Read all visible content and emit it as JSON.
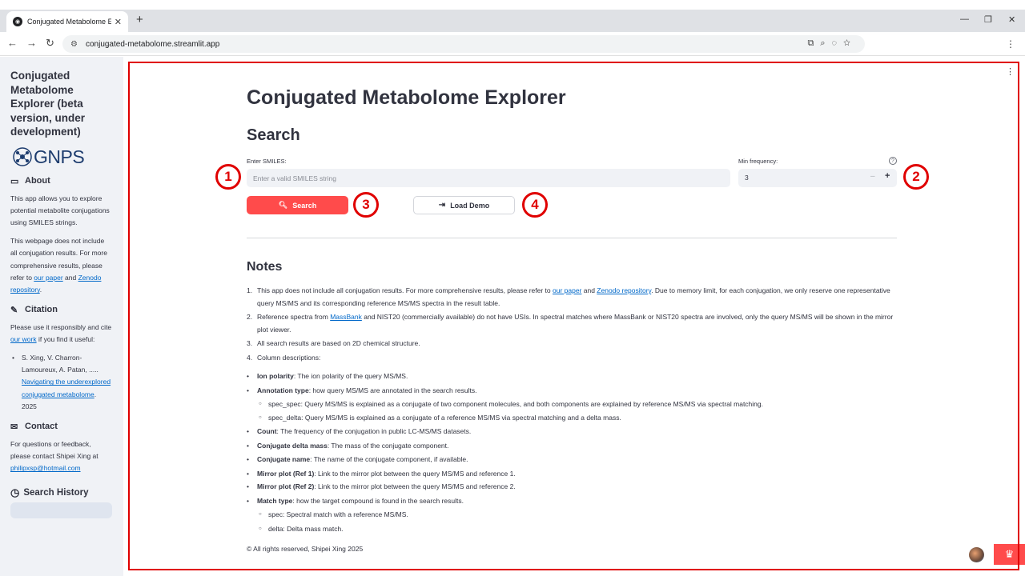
{
  "browser": {
    "tab_title": "Conjugated Metabolome Explo",
    "tab_close": "✕",
    "new_tab": "+",
    "url": "conjugated-metabolome.streamlit.app",
    "minimize": "—",
    "restore": "❐",
    "close": "✕"
  },
  "sidebar": {
    "title": "Conjugated Metabolome Explorer (beta version, under development)",
    "logo_text": "GNPS",
    "about_heading": "About",
    "about_p1": "This app allows you to explore potential metabolite conjugations using SMILES strings.",
    "about_p2_pre": "This webpage does not include all conjugation results. For more comprehensive results, please refer to ",
    "about_p2_link1": "our paper",
    "about_p2_mid": " and ",
    "about_p2_link2": "Zenodo repository",
    "about_p2_end": ".",
    "citation_heading": "Citation",
    "citation_pre": "Please use it responsibly and cite ",
    "citation_link": "our work",
    "citation_post": " if you find it useful:",
    "ref_authors": "S. Xing, V. Charron-Lamoureux, A. Patan, ..... ",
    "ref_link": "Navigating the underexplored conjugated metabolome",
    "ref_year": ". 2025",
    "contact_heading": "Contact",
    "contact_text": "For questions or feedback, please contact Shipei Xing at ",
    "contact_email": "philipxsp@hotmail.com",
    "history_heading": "Search History"
  },
  "main": {
    "title": "Conjugated Metabolome Explorer",
    "search_heading": "Search",
    "smiles_label": "Enter SMILES:",
    "smiles_placeholder": "Enter a valid SMILES string",
    "freq_label": "Min frequency:",
    "freq_value": "3",
    "freq_minus": "–",
    "freq_plus": "+",
    "help_icon": "?",
    "search_button": "Search",
    "demo_button": "Load Demo",
    "notes_heading": "Notes",
    "note1_pre": "This app does not include all conjugation results. For more comprehensive results, please refer to ",
    "note1_link1": "our paper",
    "note1_mid": " and ",
    "note1_link2": "Zenodo repository",
    "note1_post": ". Due to memory limit, for each conjugation, we only reserve one representative query MS/MS and its corresponding reference MS/MS spectra in the result table.",
    "note2_pre": "Reference spectra from ",
    "note2_link": "MassBank",
    "note2_post": " and NIST20 (commercially available) do not have USIs. In spectral matches where MassBank or NIST20 spectra are involved, only the query MS/MS will be shown in the mirror plot viewer.",
    "note3": "All search results are based on 2D chemical structure.",
    "note4": "Column descriptions:",
    "cols": [
      {
        "name": "Ion polarity",
        "desc": ": The ion polarity of the query MS/MS."
      },
      {
        "name": "Annotation type",
        "desc": ": how query MS/MS are annotated in the search results."
      },
      {
        "name": "",
        "desc": "spec_spec: Query MS/MS is explained as a conjugate of two component molecules, and both components are explained by reference MS/MS via spectral matching."
      },
      {
        "name": "",
        "desc": "spec_delta: Query MS/MS is explained as a conjugate of a reference MS/MS via spectral matching and a delta mass."
      },
      {
        "name": "Count",
        "desc": ": The frequency of the conjugation in public LC-MS/MS datasets."
      },
      {
        "name": "Conjugate delta mass",
        "desc": ": The mass of the conjugate component."
      },
      {
        "name": "Conjugate name",
        "desc": ": The name of the conjugate component, if available."
      },
      {
        "name": "Mirror plot (Ref 1)",
        "desc": ": Link to the mirror plot between the query MS/MS and reference 1."
      },
      {
        "name": "Mirror plot (Ref 2)",
        "desc": ": Link to the mirror plot between the query MS/MS and reference 2."
      },
      {
        "name": "Match type",
        "desc": ": how the target compound is found in the search results."
      },
      {
        "name": "",
        "desc": "spec: Spectral match with a reference MS/MS."
      },
      {
        "name": "",
        "desc": "delta: Delta mass match."
      }
    ],
    "footer": "© All rights reserved, Shipei Xing 2025"
  },
  "annotations": [
    "1",
    "2",
    "3",
    "4"
  ],
  "colors": {
    "primary": "#ff4b4b",
    "annotation": "#e00000",
    "link": "#0068c9",
    "sidebar_bg": "#f0f2f6"
  }
}
